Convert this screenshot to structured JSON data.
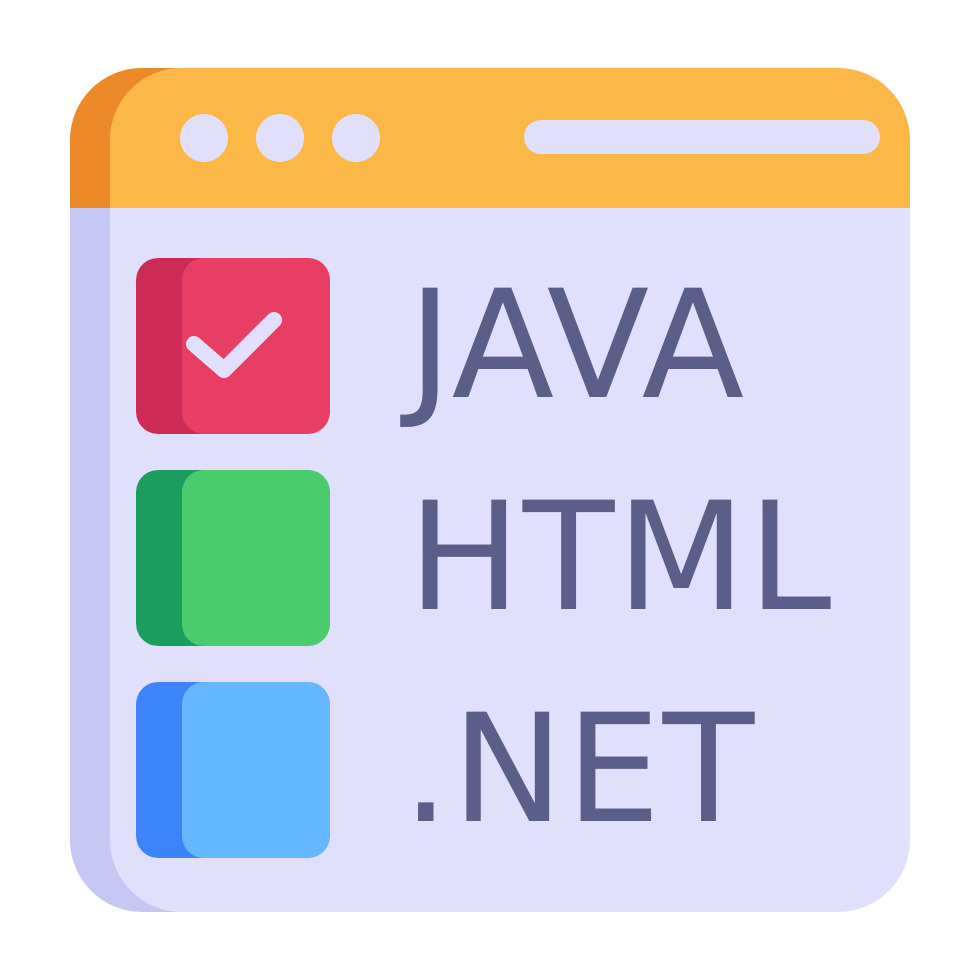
{
  "window": {
    "bar_color": "#fbb846",
    "bar_shadow_color": "#ec8a2a",
    "body_color": "#e0e0fc",
    "body_shadow_color": "#c7c7f3",
    "controls": [
      "window-dot",
      "window-dot",
      "window-dot"
    ]
  },
  "options": [
    {
      "label": "JAVA",
      "checked": true,
      "color": "#e83e64",
      "shadow_color": "#cc2b55",
      "icon": "checkmark-icon"
    },
    {
      "label": "HTML",
      "checked": false,
      "color": "#4bcc6c",
      "shadow_color": "#1a9d5e"
    },
    {
      "label": ".NET",
      "checked": false,
      "color": "#65b8ff",
      "shadow_color": "#3d83fb"
    }
  ],
  "text_color": "#5c5e8a"
}
